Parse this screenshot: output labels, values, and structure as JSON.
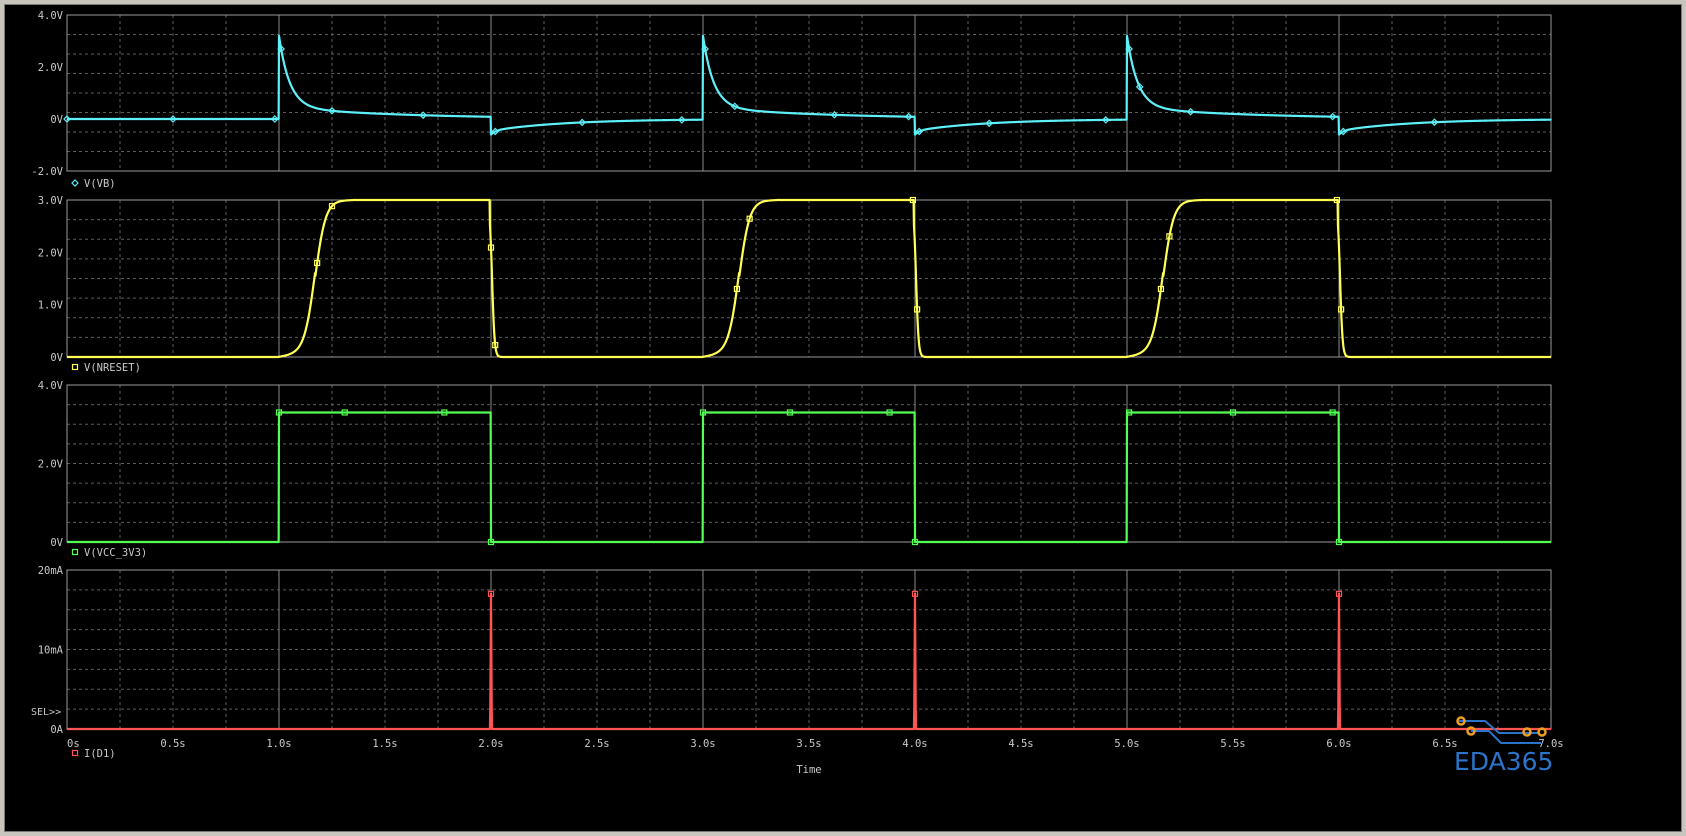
{
  "watermark": "EDA365",
  "sel_marker": "SEL>>",
  "xaxis": {
    "title": "Time",
    "range": [
      0,
      7
    ],
    "ticks": [
      0,
      0.5,
      1,
      1.5,
      2,
      2.5,
      3,
      3.5,
      4,
      4.5,
      5,
      5.5,
      6,
      6.5,
      7
    ],
    "tick_labels": [
      "0s",
      "0.5s",
      "1.0s",
      "1.5s",
      "2.0s",
      "2.5s",
      "3.0s",
      "3.5s",
      "4.0s",
      "4.5s",
      "5.0s",
      "5.5s",
      "6.0s",
      "6.5s",
      "7.0s"
    ]
  },
  "chart_data": [
    {
      "type": "line",
      "series": [
        {
          "name": "V(VB)",
          "color": "#5ef0f8",
          "marker": "diamond"
        }
      ],
      "ylim": [
        -2,
        4
      ],
      "yticks": [
        -2,
        0,
        2,
        4
      ],
      "ytick_labels": [
        "-2.0V",
        "0V",
        "2.0V",
        "4.0V"
      ],
      "events": {
        "rise_times": [
          1,
          3,
          5
        ],
        "fall_times": [
          2,
          4,
          6
        ],
        "peak": 3.2,
        "trough": -0.6
      },
      "grid": true
    },
    {
      "type": "line",
      "series": [
        {
          "name": "V(NRESET)",
          "color": "#ffff54",
          "marker": "square"
        }
      ],
      "ylim": [
        0,
        3
      ],
      "yticks": [
        0,
        1,
        2,
        3
      ],
      "ytick_labels": [
        "0V",
        "1.0V",
        "2.0V",
        "3.0V"
      ],
      "events": {
        "rise_start": [
          1,
          3,
          5
        ],
        "rise_mid": [
          1.17,
          3.17,
          5.17
        ],
        "fall_times": [
          2,
          4,
          6
        ],
        "high": 3.0
      },
      "grid": true
    },
    {
      "type": "line",
      "series": [
        {
          "name": "V(VCC_3V3)",
          "color": "#54ff54",
          "marker": "square"
        }
      ],
      "ylim": [
        0,
        4
      ],
      "yticks": [
        0,
        2,
        4
      ],
      "ytick_labels": [
        "0V",
        "2.0V",
        "4.0V"
      ],
      "events": {
        "rise_times": [
          1,
          3,
          5
        ],
        "fall_times": [
          2,
          4,
          6
        ],
        "high": 3.3
      },
      "grid": true
    },
    {
      "type": "line",
      "series": [
        {
          "name": "I(D1)",
          "color": "#ff5454",
          "marker": "square"
        }
      ],
      "ylim": [
        0,
        20
      ],
      "yticks": [
        0,
        10,
        20
      ],
      "ytick_labels": [
        "0A",
        "10mA",
        "20mA"
      ],
      "events": {
        "spike_times": [
          2,
          4,
          6
        ],
        "spike_peak_mA": 17
      },
      "grid": true
    }
  ]
}
